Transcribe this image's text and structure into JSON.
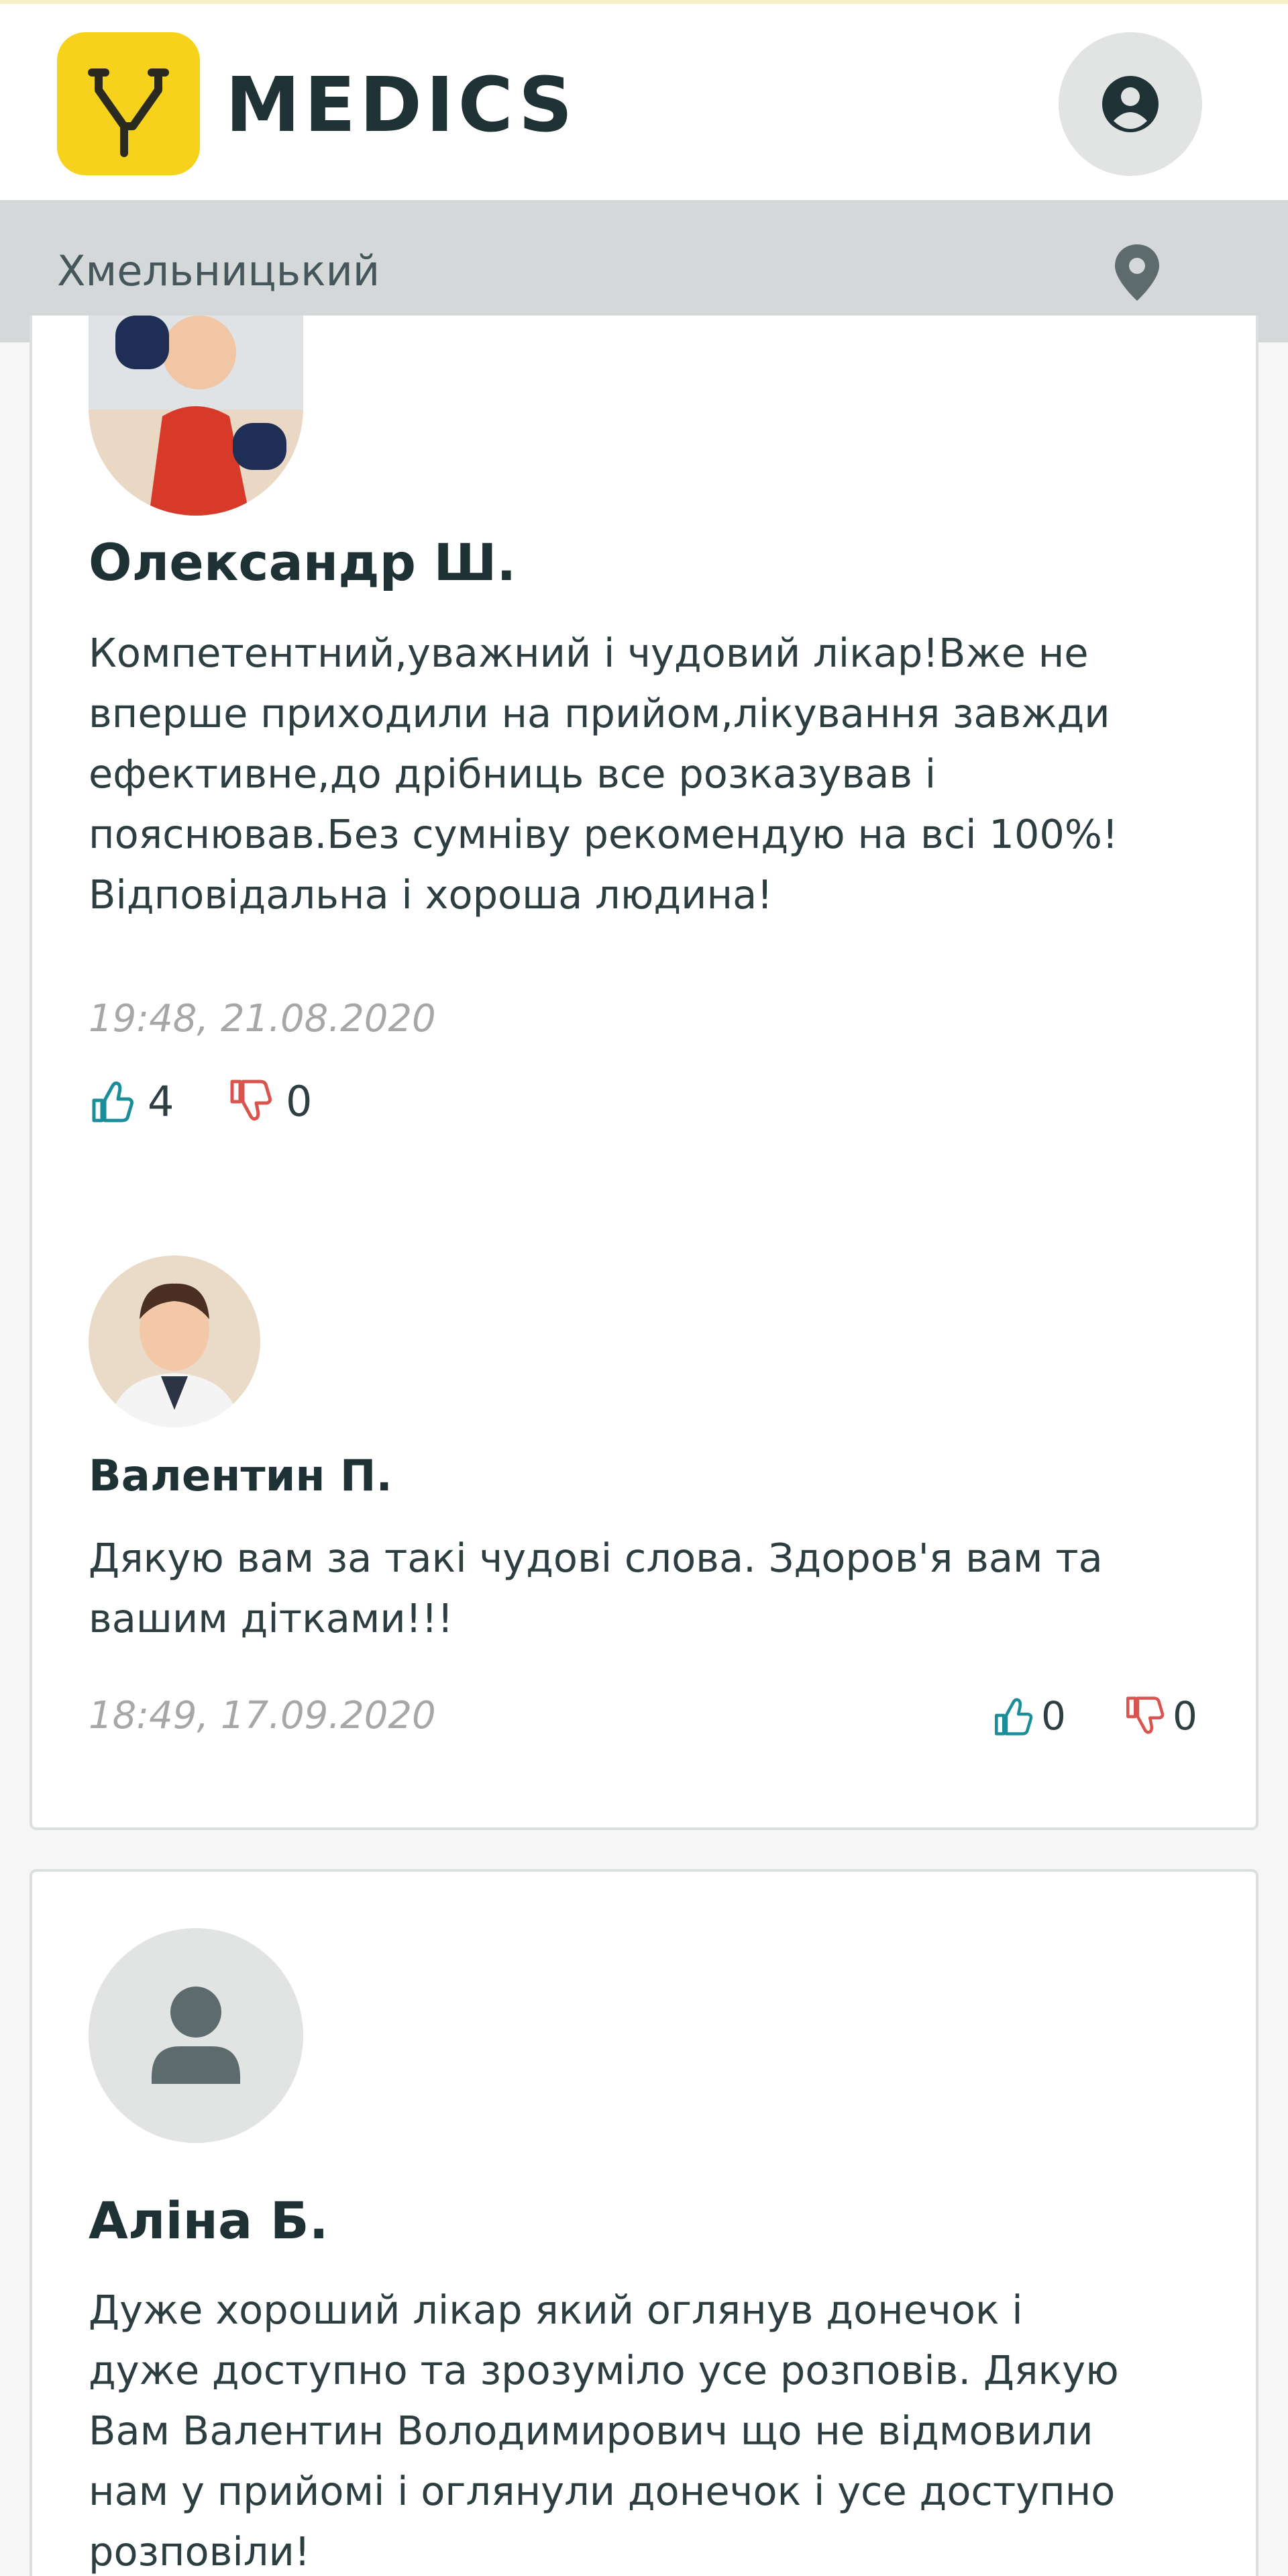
{
  "header": {
    "brand": "MEDICS",
    "logo_icon": "stethoscope-icon",
    "profile_icon": "user-circle-icon",
    "logo_color": "#f7d21d"
  },
  "location": {
    "city": "Хмельницький",
    "icon": "map-pin-icon"
  },
  "reviews": [
    {
      "author": "Олександр Ш.",
      "text": "Компетентний,уважний і чудовий лікар!Вже не\nвперше приходили на прийом,лікування завжди\nефективне,до дрібниць все розказував і\nпояснював.Без сумніву рекомендую на всі 100%!\nВідповідальна і хороша людина!",
      "timestamp": "19:48, 21.08.2020",
      "likes": "4",
      "dislikes": "0",
      "reply": {
        "author": "Валентин П.",
        "text": "Дякую вам за такі чудові слова. Здоров'я вам та\nвашим дітками!!!",
        "timestamp": "18:49, 17.09.2020",
        "likes": "0",
        "dislikes": "0"
      }
    },
    {
      "author": "Аліна Б.",
      "text": "Дуже хороший лікар який оглянув донечок і\nдуже доступно та зрозуміло усе розповів. Дякую\nВам Валентин Володимирович що не відмовили\nнам у прийомі і оглянули донечок і усе доступно\nрозповіли!"
    }
  ],
  "colors": {
    "like": "#1b8c9a",
    "dislike": "#d9534f"
  }
}
